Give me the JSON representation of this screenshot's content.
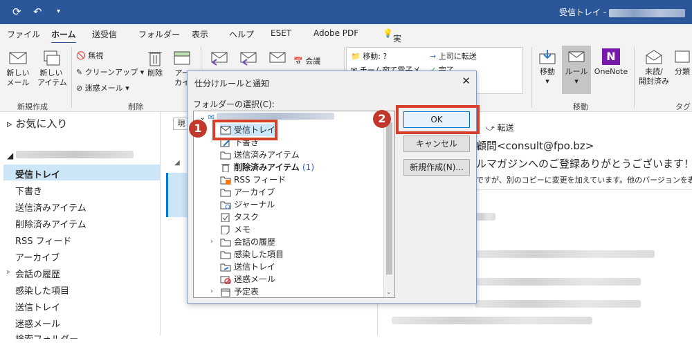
{
  "titlebar": {
    "window_title": "受信トレイ -"
  },
  "menu": {
    "items": [
      "ファイル",
      "ホーム",
      "送受信",
      "フォルダー",
      "表示",
      "ヘルプ",
      "ESET",
      "Adobe PDF"
    ],
    "tell_me": "実行したい作業を入力してください"
  },
  "ribbon": {
    "new_mail": "新しい\nメール",
    "new_item": "新しい\nアイテム",
    "ignore": "無視",
    "cleanup": "クリーンアップ",
    "junk": "迷惑メール",
    "delete": "削除",
    "archive": "アー\nカイ",
    "meeting": "会議",
    "move_to": "移動: ?",
    "team_mail": "チーム宛て電子メ...",
    "to_manager": "上司に転送",
    "done": "完了",
    "move": "移動",
    "rules": "ルール",
    "onenote": "OneNote",
    "unread_read": "未読/\n開封済み",
    "categorize": "分類",
    "group_new": "新規作成",
    "group_delete": "削除",
    "group_move": "移動",
    "group_tags": "タグ"
  },
  "left_pane": {
    "favorites": "お気に入り",
    "items": [
      "受信トレイ",
      "下書き",
      "送信済みアイテム",
      "削除済みアイテム",
      "RSS フィード",
      "アーカイブ",
      "会話の履歴",
      "感染した項目",
      "送信トレイ",
      "迷惑メール",
      "検索フォルダー"
    ]
  },
  "reading": {
    "forward": "転送",
    "sender": "顧問<consult@fpo.bz>",
    "subject": "ルマガジンへのご登録ありがとうございます！",
    "info": "ですが、別のコピーに変更を加えています。他のバージョンを表示する"
  },
  "dialog": {
    "title": "仕分けルールと通知",
    "folder_label": "フォルダーの選択(C):",
    "tree": [
      {
        "label": "受信トレイ",
        "icon": "inbox-icon"
      },
      {
        "label": "下書き",
        "icon": "draft-icon"
      },
      {
        "label": "送信済みアイテム",
        "icon": "folder-icon"
      },
      {
        "label": "削除済みアイテム",
        "count": "(1)",
        "icon": "trash-icon"
      },
      {
        "label": "RSS フィード",
        "icon": "rss-icon"
      },
      {
        "label": "アーカイブ",
        "icon": "folder-icon"
      },
      {
        "label": "ジャーナル",
        "icon": "journal-icon"
      },
      {
        "label": "タスク",
        "icon": "task-icon"
      },
      {
        "label": "メモ",
        "icon": "note-icon"
      },
      {
        "label": "会話の履歴",
        "icon": "folder-icon"
      },
      {
        "label": "感染した項目",
        "icon": "folder-icon"
      },
      {
        "label": "送信トレイ",
        "icon": "outbox-icon"
      },
      {
        "label": "迷惑メール",
        "icon": "junk-icon"
      },
      {
        "label": "予定表",
        "icon": "calendar-icon"
      }
    ],
    "ok": "OK",
    "cancel": "キャンセル",
    "new_folder": "新規作成(N)..."
  },
  "annotations": {
    "step1": "1",
    "step2": "2",
    "highlight_color": "#d6402b"
  }
}
